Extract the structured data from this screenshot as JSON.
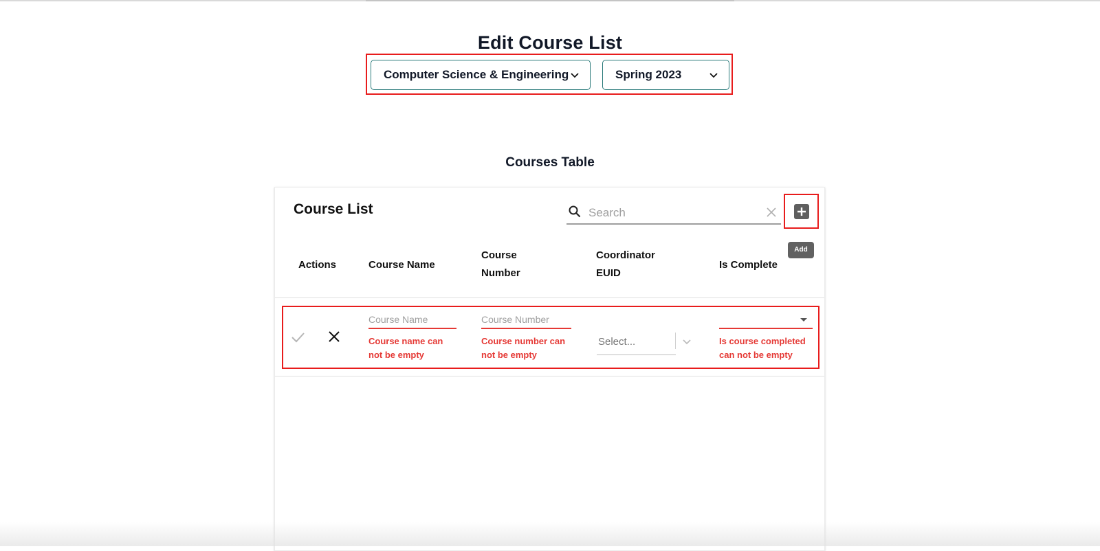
{
  "header": {
    "title": "Edit Course List",
    "department": "Computer Science & Engineering",
    "term": "Spring 2023"
  },
  "section": {
    "title": "Courses Table"
  },
  "table": {
    "title": "Course List",
    "search_placeholder": "Search",
    "add_tooltip": "Add",
    "columns": {
      "actions": "Actions",
      "course_name": "Course Name",
      "course_number_1": "Course",
      "course_number_2": "Number",
      "coordinator_1": "Coordinator",
      "coordinator_2": "EUID",
      "is_complete": "Is Complete"
    },
    "new_row": {
      "course_name_placeholder": "Course Name",
      "course_name_error_1": "Course name can",
      "course_name_error_2": "not be empty",
      "course_number_placeholder": "Course Number",
      "course_number_error_1": "Course number can",
      "course_number_error_2": "not be empty",
      "coordinator_placeholder": "Select...",
      "is_complete_error_1": "Is course completed",
      "is_complete_error_2": "can not be empty"
    }
  },
  "colors": {
    "highlight": "#e81c1c",
    "error": "#e53935",
    "select_border": "#2a7a7a"
  }
}
